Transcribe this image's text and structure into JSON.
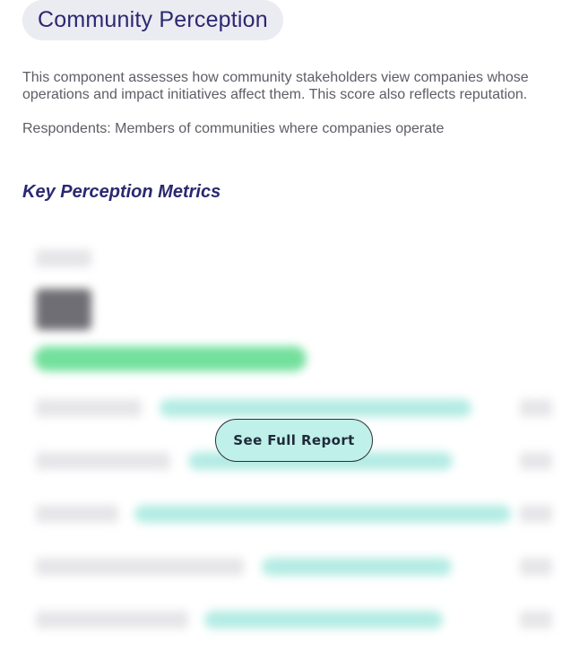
{
  "header": {
    "title": "Community Perception"
  },
  "intro": {
    "description": "This component assesses how community stakeholders view companies whose operations and impact initiatives affect them. This score also reflects reputation.",
    "respondents": "Respondents: Members of communities where companies operate"
  },
  "metrics": {
    "heading": "Key Perception Metrics",
    "overall": {
      "progress_fraction": 0.53
    },
    "rows": [
      {
        "progress_fraction": 0.67
      },
      {
        "progress_fraction": 0.62
      },
      {
        "progress_fraction": 0.74
      },
      {
        "progress_fraction": 0.56
      },
      {
        "progress_fraction": 0.59
      }
    ]
  },
  "cta": {
    "label": "See Full Report"
  },
  "colors": {
    "title_text": "#2b2870",
    "pill_background": "#ebebf2",
    "overall_bar": "#74e09d",
    "metric_bar": "#b4ece4",
    "cta_background": "#bff0ea"
  }
}
